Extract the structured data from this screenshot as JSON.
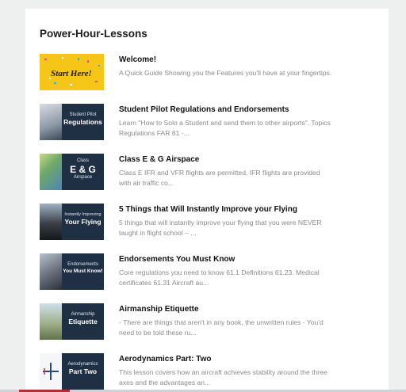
{
  "section": {
    "title": "Power-Hour-Lessons"
  },
  "lessons": [
    {
      "title": "Welcome!",
      "description": "A Quick Guide Showing you the Features you'll have at your fingertips.",
      "thumb_small": "",
      "thumb_big": "Start Here!"
    },
    {
      "title": "Student Pilot Regulations and Endorsements",
      "description": "Learn \"How to Solo a Student and send them to other airports\".  Topics Regulations  FAR 61 -...",
      "thumb_small": "Student Pilot",
      "thumb_big": "Regulations"
    },
    {
      "title": "Class E & G Airspace",
      "description": "Class E  IFR and VFR flights are permitted.  IFR flights are provided with air traffic co...",
      "thumb_small": "Class",
      "thumb_big": "E & G",
      "thumb_extra": "Airspace"
    },
    {
      "title": "5 Things that Will Instantly Improve your Flying",
      "description": "5 things that will instantly improve your flying that you were NEVER taught in flight school –  ...",
      "thumb_small": "Instantly Improving",
      "thumb_big": "Your Flying"
    },
    {
      "title": "Endorsements You Must Know",
      "description": "Core regulations you need to know 61.1 Definitions 61.23. Medical certificates 61.31 Aircraft au...",
      "thumb_small": "Endorsements",
      "thumb_big": "You Must Know!"
    },
    {
      "title": "Airmanship Etiquette",
      "description": "- There are things that aren't in any book, the unwritten rules - You'd need to be told these ru...",
      "thumb_small": "Airmanship",
      "thumb_big": "Etiquette"
    },
    {
      "title": "Aerodynamics Part: Two",
      "description": "This lesson covers how an aircraft achieves stability around the three axes and the advantages an...",
      "thumb_small": "Aerodynamics",
      "thumb_big": "Part Two"
    }
  ],
  "colors": {
    "panel": "#1f2f44",
    "welcome_bg": "#f5c518",
    "scrollbar_thumb": "#b03030"
  },
  "icons": {
    "thumbnail": "lesson-thumbnail-image"
  }
}
